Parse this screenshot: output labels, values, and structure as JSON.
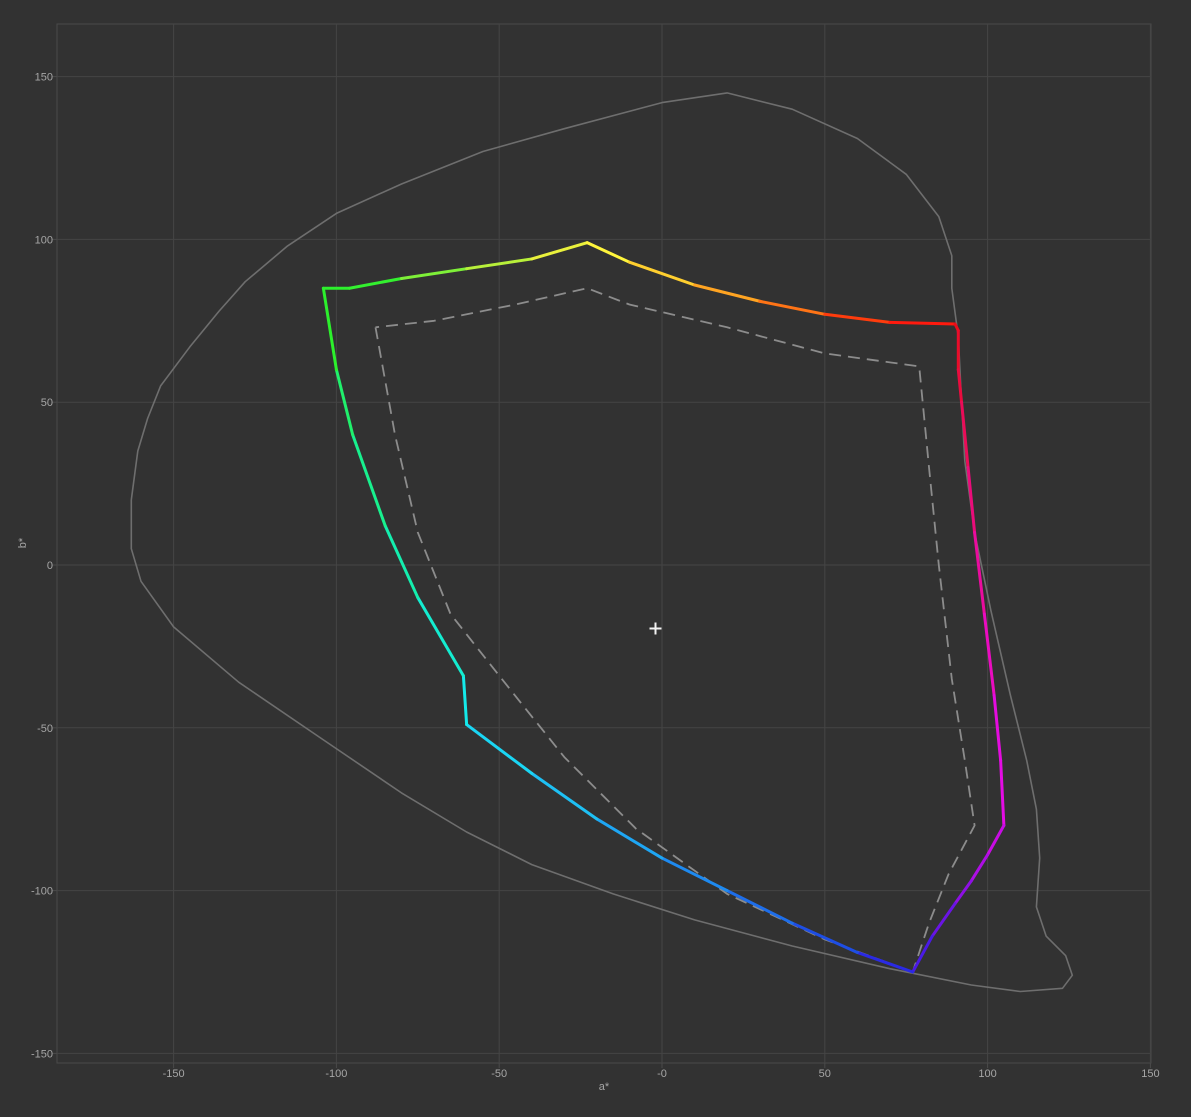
{
  "chart_data": {
    "type": "line",
    "title": "",
    "xlabel": "a*",
    "ylabel": "b*",
    "xlim": [
      -185,
      150
    ],
    "ylim": [
      -152,
      166
    ],
    "grid": true,
    "x_ticks": [
      -150,
      -100,
      -50,
      0,
      50,
      100,
      150
    ],
    "x_tick_labels": [
      "-150",
      "-100",
      "-50",
      "-0",
      "50",
      "100",
      "150"
    ],
    "y_ticks": [
      150,
      100,
      50,
      0,
      -50,
      -100,
      -150
    ],
    "y_tick_labels": [
      "150",
      "100",
      "50",
      "0",
      "-50",
      "-100",
      "-150"
    ],
    "white_point": [
      -2,
      -19.5
    ],
    "colors": {
      "background": "#323232",
      "plot_border": "#4a4a4a",
      "grid": "#454545",
      "tick_label": "#a6a6a6",
      "reference_outline": "#6e6e6e",
      "secondary_gamut": "#8c8c8c",
      "white_point": "#f2f2f2"
    },
    "series": [
      {
        "style": "solid-gray",
        "points": [
          [
            -163,
            20
          ],
          [
            -161,
            35
          ],
          [
            -158,
            45
          ],
          [
            -154,
            55
          ],
          [
            -145,
            67
          ],
          [
            -136,
            78
          ],
          [
            -128,
            87
          ],
          [
            -115,
            98
          ],
          [
            -100,
            108
          ],
          [
            -80,
            117
          ],
          [
            -55,
            127
          ],
          [
            -30,
            134
          ],
          [
            0,
            142
          ],
          [
            20,
            145
          ],
          [
            40,
            140
          ],
          [
            60,
            131
          ],
          [
            75,
            120
          ],
          [
            85,
            107
          ],
          [
            89,
            95
          ],
          [
            89,
            85
          ],
          [
            91,
            70
          ],
          [
            92,
            50
          ],
          [
            93,
            32
          ],
          [
            96,
            10
          ],
          [
            101,
            -14
          ],
          [
            107,
            -40
          ],
          [
            112,
            -60
          ],
          [
            115,
            -75
          ],
          [
            116,
            -90
          ],
          [
            115,
            -105
          ],
          [
            118,
            -114
          ],
          [
            124,
            -120
          ],
          [
            126,
            -126
          ],
          [
            123,
            -130
          ],
          [
            110,
            -131
          ],
          [
            95,
            -129
          ],
          [
            70,
            -124
          ],
          [
            40,
            -117
          ],
          [
            10,
            -109
          ],
          [
            -15,
            -101
          ],
          [
            -40,
            -92
          ],
          [
            -60,
            -82
          ],
          [
            -80,
            -70
          ],
          [
            -105,
            -53
          ],
          [
            -130,
            -36
          ],
          [
            -150,
            -19
          ],
          [
            -160,
            -5
          ],
          [
            -163,
            5
          ],
          [
            -163,
            20
          ]
        ]
      },
      {
        "style": "dashed-gray",
        "points": [
          [
            -88,
            73
          ],
          [
            -82,
            40
          ],
          [
            -75,
            10
          ],
          [
            -65,
            -15
          ],
          [
            -50,
            -34
          ],
          [
            -30,
            -59
          ],
          [
            -8,
            -81
          ],
          [
            20,
            -101
          ],
          [
            50,
            -115
          ],
          [
            77,
            -125
          ],
          [
            82,
            -110
          ],
          [
            88,
            -95
          ],
          [
            96,
            -80
          ],
          [
            93,
            -60
          ],
          [
            89,
            -35
          ],
          [
            85,
            0
          ],
          [
            82,
            30
          ],
          [
            79,
            61
          ],
          [
            50,
            65
          ],
          [
            20,
            73
          ],
          [
            -10,
            80
          ],
          [
            -23,
            85
          ],
          [
            -45,
            80
          ],
          [
            -70,
            75
          ],
          [
            -88,
            73
          ]
        ]
      },
      {
        "style": "rainbow",
        "points": [
          [
            -104,
            85
          ],
          [
            -96,
            85
          ],
          [
            -80,
            88
          ],
          [
            -60,
            91
          ],
          [
            -40,
            94
          ],
          [
            -23,
            99
          ],
          [
            -10,
            93
          ],
          [
            10,
            86
          ],
          [
            30,
            81
          ],
          [
            50,
            77
          ],
          [
            70,
            74.5
          ],
          [
            90,
            74
          ],
          [
            91,
            72
          ],
          [
            91,
            60
          ],
          [
            92,
            50
          ],
          [
            94,
            30
          ],
          [
            96,
            10
          ],
          [
            99,
            -15
          ],
          [
            102,
            -40
          ],
          [
            104,
            -60
          ],
          [
            105,
            -80
          ],
          [
            100,
            -89
          ],
          [
            95,
            -97
          ],
          [
            90,
            -104
          ],
          [
            83,
            -114
          ],
          [
            77,
            -125
          ],
          [
            60,
            -119
          ],
          [
            40,
            -110
          ],
          [
            20,
            -100
          ],
          [
            0,
            -90
          ],
          [
            -20,
            -78
          ],
          [
            -40,
            -64
          ],
          [
            -60,
            -49
          ],
          [
            -61,
            -34
          ],
          [
            -75,
            -10
          ],
          [
            -85,
            12
          ],
          [
            -95,
            40
          ],
          [
            -100,
            60
          ],
          [
            -104,
            85
          ]
        ],
        "colors": [
          "#2cf02c",
          "#33f02f",
          "#7ef038",
          "#b8f03a",
          "#e9f03c",
          "#fff53c",
          "#ffcf2f",
          "#ffa422",
          "#ff7416",
          "#ff3c0d",
          "#ff1a0e",
          "#ea0c1a",
          "#ea0c2a",
          "#ea0c3e",
          "#ea0c58",
          "#ea0c7a",
          "#ea0c9e",
          "#ea0cc0",
          "#e40cdf",
          "#e40ce4",
          "#c80ce4",
          "#ae0ee4",
          "#8e10e4",
          "#6a14e4",
          "#4a1ae4",
          "#2a2ae4",
          "#1e4ee4",
          "#1e6eea",
          "#1e8af0",
          "#1ea6f4",
          "#1ec0f4",
          "#1ad6f4",
          "#14eaea",
          "#14ecd0",
          "#14eeae",
          "#18f08e",
          "#20f06c",
          "#2cf02c"
        ]
      }
    ]
  }
}
